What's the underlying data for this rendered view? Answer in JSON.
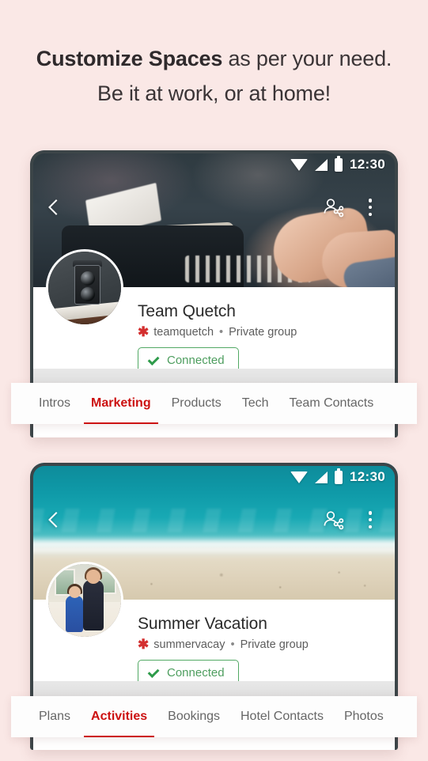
{
  "headline": {
    "strong": "Customize Spaces",
    "rest": " as per your need. Be it at work, or at home!"
  },
  "colors": {
    "background": "#fae8e6",
    "accent_red": "#cc1111",
    "connected_green": "#4e9e5f",
    "asterisk_red": "#d32f2f",
    "bezel": "#3c4548"
  },
  "cards": [
    {
      "status_bar": {
        "time": "12:30",
        "icons": [
          "wifi-icon",
          "signal-icon",
          "battery-icon"
        ]
      },
      "hero": {
        "image_description": "vintage typewriter with hands typing",
        "back_icon": "back-chevron-icon",
        "share_icon": "add-person-share-icon",
        "overflow_icon": "overflow-menu-icon"
      },
      "profile": {
        "avatar_description": "vintage twin-lens camera on a shelf",
        "title": "Team Quetch",
        "handle": "teamquetch",
        "separator": "•",
        "privacy": "Private group",
        "asterisk_icon": "asterisk-icon",
        "connect_button": {
          "label": "Connected",
          "icon": "check-icon"
        }
      },
      "tabs": [
        {
          "label": "Intros",
          "active": false
        },
        {
          "label": "Marketing",
          "active": true
        },
        {
          "label": "Products",
          "active": false
        },
        {
          "label": "Tech",
          "active": false
        },
        {
          "label": "Team Contacts",
          "active": false
        }
      ]
    },
    {
      "status_bar": {
        "time": "12:30",
        "icons": [
          "wifi-icon",
          "signal-icon",
          "battery-icon"
        ]
      },
      "hero": {
        "image_description": "turquoise ocean meeting sandy beach",
        "back_icon": "back-chevron-icon",
        "share_icon": "add-person-share-icon",
        "overflow_icon": "overflow-menu-icon"
      },
      "profile": {
        "avatar_description": "woman and child outdoors",
        "title": "Summer Vacation",
        "handle": "summervacay",
        "separator": "•",
        "privacy": "Private group",
        "asterisk_icon": "asterisk-icon",
        "connect_button": {
          "label": "Connected",
          "icon": "check-icon"
        }
      },
      "tabs": [
        {
          "label": "Plans",
          "active": false
        },
        {
          "label": "Activities",
          "active": true
        },
        {
          "label": "Bookings",
          "active": false
        },
        {
          "label": "Hotel Contacts",
          "active": false
        },
        {
          "label": "Photos",
          "active": false
        }
      ]
    }
  ]
}
